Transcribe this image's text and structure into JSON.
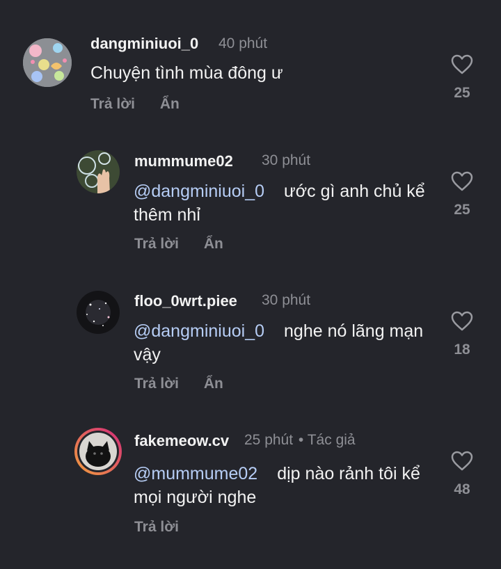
{
  "comments": [
    {
      "username": "dangminiuoi_0",
      "time": "40 phút",
      "mention": "",
      "text": "Chuyện tình mùa đông ư",
      "reply": "Trả lời",
      "hide": "Ẩn",
      "likes": "25",
      "avatar": "avatar-sticker-collage"
    },
    {
      "username": "mummume02",
      "time": "30 phút",
      "mention": "@dangminiuoi_0",
      "text": "ước gì anh chủ kể thêm nhỉ",
      "reply": "Trả lời",
      "hide": "Ẩn",
      "likes": "25",
      "avatar": "avatar-hand-bubbles"
    },
    {
      "username": "floo_0wrt.piee",
      "time": "30 phút",
      "mention": "@dangminiuoi_0",
      "text": "nghe nó lãng mạn vậy",
      "reply": "Trả lời",
      "hide": "Ẩn",
      "likes": "18",
      "avatar": "avatar-dark-sparkle"
    },
    {
      "username": "fakemeow.cv",
      "time": "25 phút",
      "author_tag": "• Tác giả",
      "mention": "@mummume02",
      "text": "dịp nào rảnh tôi kể mọi người nghe",
      "reply": "Trả lời",
      "likes": "48",
      "avatar": "avatar-black-cat-story-ring"
    }
  ],
  "colors": {
    "background": "#24252b",
    "primary_text": "#f2f2f2",
    "secondary_text": "#8e8f95",
    "mention": "#b6cdf5",
    "story_ring_start": "#f2a03d",
    "story_ring_end": "#d3297a"
  }
}
